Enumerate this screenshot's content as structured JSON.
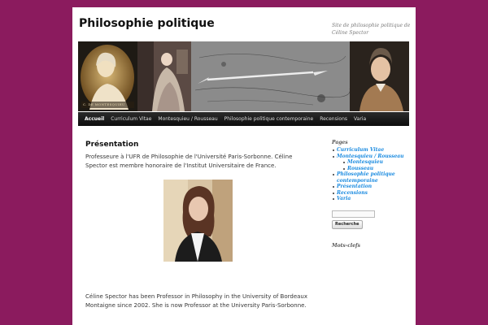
{
  "site": {
    "title": "Philosophie politique",
    "description": "Site de philosophie politique de Céline Spector"
  },
  "banner": {
    "caption": "C. DE MONTESQUIEU"
  },
  "nav": {
    "items": [
      {
        "label": "Accueil",
        "active": true
      },
      {
        "label": "Curriculum Vitae",
        "active": false
      },
      {
        "label": "Montesquieu / Rousseau",
        "active": false
      },
      {
        "label": "Philosophie politique contemporaine",
        "active": false
      },
      {
        "label": "Recensions",
        "active": false
      },
      {
        "label": "Varia",
        "active": false
      }
    ]
  },
  "main": {
    "title": "Présentation",
    "intro": "Professeure à l'UFR de Philosophie de l'Université Paris-Sorbonne. Céline Spector est membre honoraire de l'Institut Universitaire de France.",
    "bio": "Céline Spector has been Professor in Philosophy in the University of Bordeaux Montaigne since 2002. She is now Professor at the University Paris-Sorbonne."
  },
  "sidebar": {
    "pages_title": "Pages",
    "pages": [
      {
        "label": "Curriculum Vitae"
      },
      {
        "label": "Montesquieu / Rousseau",
        "children": [
          "Montesquieu",
          "Rousseau"
        ]
      },
      {
        "label": "Philosophie politique contemporaine"
      },
      {
        "label": "Présentation"
      },
      {
        "label": "Recensions"
      },
      {
        "label": "Varia"
      }
    ],
    "search_input_value": "",
    "search_button_label": "Recherche",
    "tags_title": "Mots-clefs"
  },
  "colors": {
    "background": "#8b1b5e",
    "link": "#1b8be0",
    "nav_bar": "#1a1a1a"
  }
}
